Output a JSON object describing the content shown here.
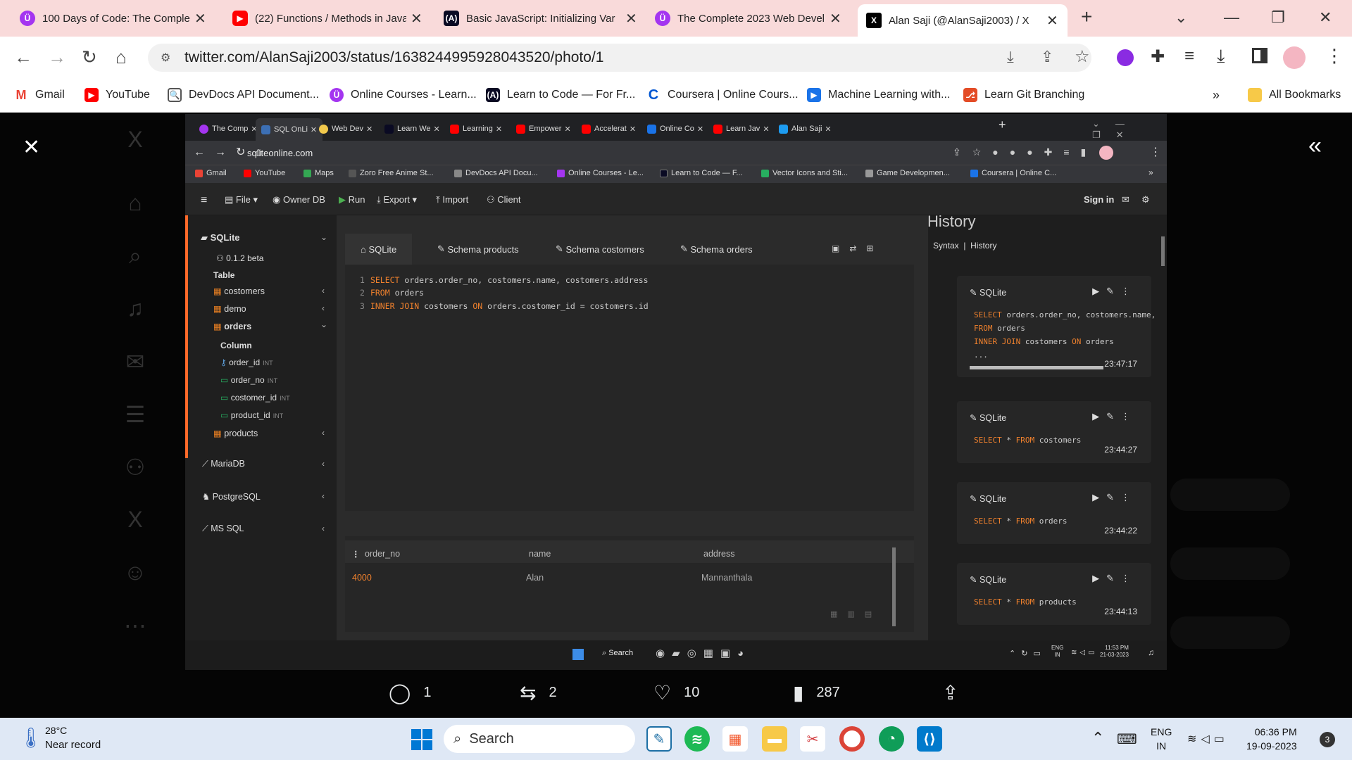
{
  "browser": {
    "tabs": [
      {
        "title": "100 Days of Code: The Complete",
        "favicon": "udemy-icon"
      },
      {
        "title": "(22) Functions / Methods in Java",
        "favicon": "youtube-icon"
      },
      {
        "title": "Basic JavaScript: Initializing Var",
        "favicon": "freecodecamp-icon"
      },
      {
        "title": "The Complete 2023 Web Devel",
        "favicon": "udemy-icon"
      },
      {
        "title": "Alan Saji (@AlanSaji2003) / X",
        "favicon": "x-icon"
      }
    ],
    "url": "twitter.com/AlanSaji2003/status/1638244995928043520/photo/1",
    "bookmarks": [
      "Gmail",
      "YouTube",
      "DevDocs API Document...",
      "Online Courses - Learn...",
      "Learn to Code — For Fr...",
      "Coursera | Online Cours...",
      "Machine Learning with...",
      "Learn Git Branching"
    ],
    "more": "»",
    "all_bookmarks": "All Bookmarks"
  },
  "inner": {
    "tabs": [
      "The Comp",
      "SQL OnLi",
      "Web Dev",
      "Learn We",
      "Learning",
      "Empower",
      "Accelerat",
      "Online Co",
      "Learn Jav",
      "Alan Saji"
    ],
    "url": "sqliteonline.com",
    "bookmarks": [
      "Gmail",
      "YouTube",
      "Maps",
      "Zoro Free Anime St...",
      "DevDocs API Docu...",
      "Online Courses - Le...",
      "Learn to Code — F...",
      "Vector Icons and Sti...",
      "Game Developmen...",
      "Coursera | Online C..."
    ],
    "toolbar": {
      "file": "File",
      "owner_db": "Owner DB",
      "run": "Run",
      "export": "Export",
      "import": "Import",
      "client": "Client",
      "signin": "Sign in"
    },
    "sidebar": {
      "sqlite": "SQLite",
      "version": "0.1.2 beta",
      "table_header": "Table",
      "tables": [
        "costomers",
        "demo",
        "orders"
      ],
      "column_header": "Column",
      "columns": [
        {
          "name": "order_id",
          "type": "INT"
        },
        {
          "name": "order_no",
          "type": "INT"
        },
        {
          "name": "costomer_id",
          "type": "INT"
        },
        {
          "name": "product_id",
          "type": "INT"
        }
      ],
      "products": "products",
      "mariadb": "MariaDB",
      "postgresql": "PostgreSQL",
      "mssql": "MS SQL"
    },
    "query_tabs": [
      "SQLite",
      "Schema products",
      "Schema costomers",
      "Schema orders"
    ],
    "editor": {
      "line1_kw": "SELECT",
      "line1_rest": " orders.order_no, costomers.name, costomers.address",
      "line2_kw": "FROM",
      "line2_rest": " orders",
      "line3_kw1": "INNER JOIN",
      "line3_mid": " costomers ",
      "line3_kw2": "ON",
      "line3_rest": " orders.costomer_id = costomers.id"
    },
    "results": {
      "columns": [
        "order_no",
        "name",
        "address"
      ],
      "row": [
        "4000",
        "Alan",
        "Mannanthala"
      ]
    },
    "history": {
      "title": "History",
      "links": "Syntax  |  History",
      "cards": [
        {
          "engine": "SQLite",
          "time": "23:47:17"
        },
        {
          "engine": "SQLite",
          "code_kw": "SELECT",
          "code_mid": " * ",
          "code_kw2": "FROM",
          "code_rest": " costomers",
          "time": "23:44:27"
        },
        {
          "engine": "SQLite",
          "code_kw": "SELECT",
          "code_mid": " * ",
          "code_kw2": "FROM",
          "code_rest": " orders",
          "time": "23:44:22"
        },
        {
          "engine": "SQLite",
          "code_kw": "SELECT",
          "code_mid": " * ",
          "code_kw2": "FROM",
          "code_rest": " products",
          "time": "23:44:13"
        }
      ],
      "card1_lines": {
        "l1_kw": "SELECT",
        "l1": " orders.order_no, costomers.name,",
        "l2_kw": "FROM",
        "l2": " orders",
        "l3_kw": "INNER JOIN",
        "l3": " costomers ",
        "l3_kw2": "ON",
        "l3b": " orders",
        "l4": "..."
      }
    },
    "taskbar": {
      "search": "Search",
      "lang": "ENG",
      "region": "IN",
      "time": "11:53 PM",
      "date": "21-03-2023"
    }
  },
  "tweet": {
    "replies": "1",
    "retweets": "2",
    "likes": "10",
    "views": "287"
  },
  "taskbar": {
    "weather_temp": "28°C",
    "weather_desc": "Near record",
    "search": "Search",
    "lang": "ENG",
    "region": "IN",
    "time": "06:36 PM",
    "date": "19-09-2023",
    "notifications": "3"
  }
}
